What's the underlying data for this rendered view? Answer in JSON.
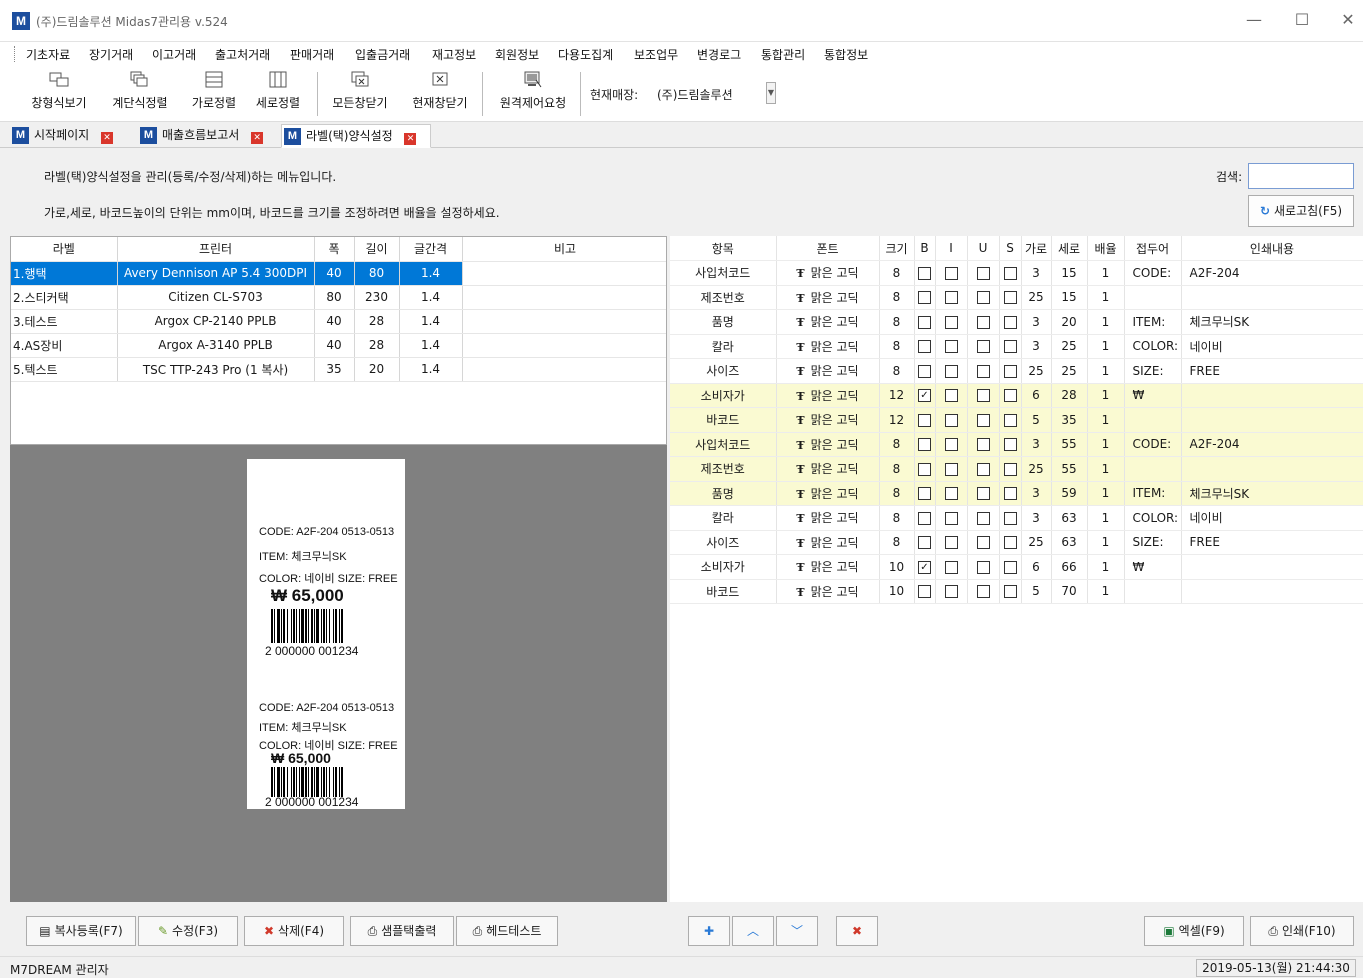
{
  "window": {
    "title": "(주)드림솔루션 Midas7관리용 v.524",
    "app_icon_letter": "M",
    "minimize": "—",
    "maximize": "☐",
    "close": "✕"
  },
  "menu": [
    "기초자료",
    "장기거래",
    "이고거래",
    "출고처거래",
    "판매거래",
    "입출금거래",
    "재고정보",
    "회원정보",
    "다용도집계",
    "보조업무",
    "변경로그",
    "통합관리",
    "통합정보"
  ],
  "toolbar": {
    "tools": [
      "창형식보기",
      "계단식정렬",
      "가로정렬",
      "세로정렬",
      "모든창닫기",
      "현재창닫기",
      "원격제어요청"
    ],
    "store_label": "현재매장:",
    "store_value": "(주)드림솔루션"
  },
  "tabs": [
    {
      "label": "시작페이지"
    },
    {
      "label": "매출흐름보고서"
    },
    {
      "label": "라벨(택)양식설정"
    }
  ],
  "description": {
    "line1": "라벨(택)양식설정을 관리(등록/수정/삭제)하는 메뉴입니다.",
    "line2": "가로,세로, 바코드높이의 단위는 mm이며, 바코드를 크기를 조정하려면 배율을 설정하세요."
  },
  "search": {
    "label": "검색:",
    "value": ""
  },
  "refresh_button": "새로고침(F5)",
  "label_grid": {
    "columns": [
      "라벨",
      "프린터",
      "폭",
      "길이",
      "글간격",
      "비고"
    ],
    "rows": [
      [
        "1.행택",
        "Avery Dennison AP 5.4 300DPI",
        "40",
        "80",
        "1.4",
        ""
      ],
      [
        "2.스티커택",
        "Citizen CL-S703",
        "80",
        "230",
        "1.4",
        ""
      ],
      [
        "3.테스트",
        "Argox CP-2140 PPLB",
        "40",
        "28",
        "1.4",
        ""
      ],
      [
        "4.AS장비",
        "Argox A-3140 PPLB",
        "40",
        "28",
        "1.4",
        ""
      ],
      [
        "5.텍스트",
        "TSC TTP-243 Pro (1 복사)",
        "35",
        "20",
        "1.4",
        ""
      ]
    ],
    "selected_row": 0
  },
  "preview": {
    "block1": {
      "code": "CODE:  A2F-204  0513-0513",
      "item": "ITEM: 체크무늬SK",
      "color_size": "COLOR: 네이비    SIZE: FREE",
      "price": "₩ 65,000",
      "barcode_text": "2 000000 001234"
    },
    "block2": {
      "code": "CODE: A2F-204  0513-0513",
      "item": "ITEM: 체크무늬SK",
      "color_size": "COLOR: 네이비    SIZE: FREE",
      "price": "₩ 65,000",
      "barcode_text": "2 000000 001234"
    }
  },
  "item_grid": {
    "columns": [
      "항목",
      "폰트",
      "크기",
      "B",
      "I",
      "U",
      "S",
      "가로",
      "세로",
      "배율",
      "접두어",
      "인쇄내용"
    ],
    "font_icon": "Ŧ",
    "rows": [
      {
        "item": "사입처코드",
        "font": "맑은 고딕",
        "size": "8",
        "b": false,
        "i": false,
        "u": false,
        "s": false,
        "x": "3",
        "y": "15",
        "scale": "1",
        "prefix": "CODE:",
        "content": "A2F-204",
        "hl": false
      },
      {
        "item": "제조번호",
        "font": "맑은 고딕",
        "size": "8",
        "b": false,
        "i": false,
        "u": false,
        "s": false,
        "x": "25",
        "y": "15",
        "scale": "1",
        "prefix": "",
        "content": "",
        "hl": false
      },
      {
        "item": "품명",
        "font": "맑은 고딕",
        "size": "8",
        "b": false,
        "i": false,
        "u": false,
        "s": false,
        "x": "3",
        "y": "20",
        "scale": "1",
        "prefix": "ITEM:",
        "content": "체크무늬SK",
        "hl": false
      },
      {
        "item": "칼라",
        "font": "맑은 고딕",
        "size": "8",
        "b": false,
        "i": false,
        "u": false,
        "s": false,
        "x": "3",
        "y": "25",
        "scale": "1",
        "prefix": "COLOR:",
        "content": "네이비",
        "hl": false
      },
      {
        "item": "사이즈",
        "font": "맑은 고딕",
        "size": "8",
        "b": false,
        "i": false,
        "u": false,
        "s": false,
        "x": "25",
        "y": "25",
        "scale": "1",
        "prefix": "SIZE:",
        "content": "FREE",
        "hl": false
      },
      {
        "item": "소비자가",
        "font": "맑은 고딕",
        "size": "12",
        "b": true,
        "i": false,
        "u": false,
        "s": false,
        "x": "6",
        "y": "28",
        "scale": "1",
        "prefix": "₩",
        "content": "",
        "hl": true
      },
      {
        "item": "바코드",
        "font": "맑은 고딕",
        "size": "12",
        "b": false,
        "i": false,
        "u": false,
        "s": false,
        "x": "5",
        "y": "35",
        "scale": "1",
        "prefix": "",
        "content": "",
        "hl": true
      },
      {
        "item": "사입처코드",
        "font": "맑은 고딕",
        "size": "8",
        "b": false,
        "i": false,
        "u": false,
        "s": false,
        "x": "3",
        "y": "55",
        "scale": "1",
        "prefix": "CODE:",
        "content": "A2F-204",
        "hl": true
      },
      {
        "item": "제조번호",
        "font": "맑은 고딕",
        "size": "8",
        "b": false,
        "i": false,
        "u": false,
        "s": false,
        "x": "25",
        "y": "55",
        "scale": "1",
        "prefix": "",
        "content": "",
        "hl": true
      },
      {
        "item": "품명",
        "font": "맑은 고딕",
        "size": "8",
        "b": false,
        "i": false,
        "u": false,
        "s": false,
        "x": "3",
        "y": "59",
        "scale": "1",
        "prefix": "ITEM:",
        "content": "체크무늬SK",
        "hl": true
      },
      {
        "item": "칼라",
        "font": "맑은 고딕",
        "size": "8",
        "b": false,
        "i": false,
        "u": false,
        "s": false,
        "x": "3",
        "y": "63",
        "scale": "1",
        "prefix": "COLOR:",
        "content": "네이비",
        "hl": false
      },
      {
        "item": "사이즈",
        "font": "맑은 고딕",
        "size": "8",
        "b": false,
        "i": false,
        "u": false,
        "s": false,
        "x": "25",
        "y": "63",
        "scale": "1",
        "prefix": "SIZE:",
        "content": "FREE",
        "hl": false
      },
      {
        "item": "소비자가",
        "font": "맑은 고딕",
        "size": "10",
        "b": true,
        "i": false,
        "u": false,
        "s": false,
        "x": "6",
        "y": "66",
        "scale": "1",
        "prefix": "₩",
        "content": "",
        "hl": false
      },
      {
        "item": "바코드",
        "font": "맑은 고딕",
        "size": "10",
        "b": false,
        "i": false,
        "u": false,
        "s": false,
        "x": "5",
        "y": "70",
        "scale": "1",
        "prefix": "",
        "content": "",
        "hl": false
      }
    ]
  },
  "bottom_buttons": {
    "copy_register": "복사등록(F7)",
    "edit": "수정(F3)",
    "delete": "삭제(F4)",
    "sample_print": "샘플택출력",
    "head_test": "헤드테스트",
    "excel": "엑셀(F9)",
    "print": "인쇄(F10)"
  },
  "status": {
    "user": "M7DREAM  관리자",
    "datetime": "2019-05-13(월) 21:44:30"
  },
  "colors": {
    "selection": "#0078d7",
    "highlight_row": "#fafad2",
    "preview_bg": "#808080",
    "brand": "#1c4e9e"
  }
}
